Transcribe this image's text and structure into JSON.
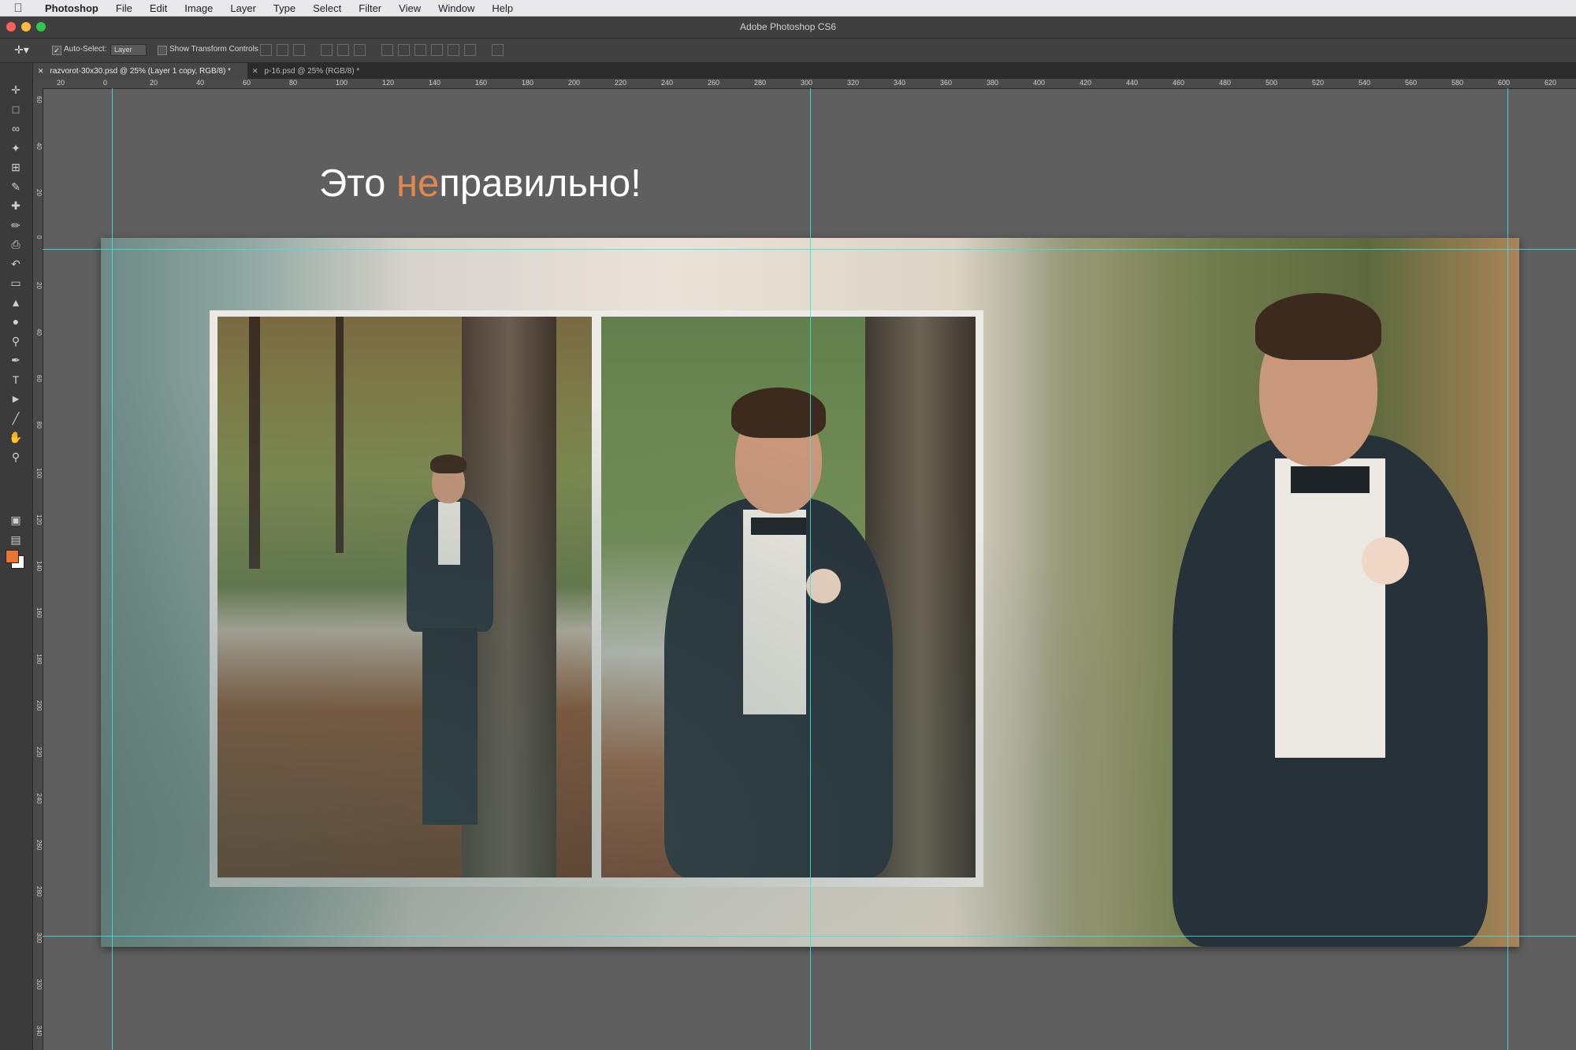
{
  "menubar": {
    "app": "Photoshop",
    "items": [
      "File",
      "Edit",
      "Image",
      "Layer",
      "Type",
      "Select",
      "Filter",
      "View",
      "Window",
      "Help"
    ]
  },
  "window": {
    "title": "Adobe Photoshop CS6"
  },
  "options_bar": {
    "auto_select_label": "Auto-Select:",
    "auto_select_checked": true,
    "auto_select_value": "Layer",
    "transform_label": "Show Transform Controls",
    "transform_checked": false
  },
  "tabs": [
    {
      "label": "razvorot-30x30.psd @ 25% (Layer 1 copy, RGB/8) *",
      "active": true
    },
    {
      "label": "p-16.psd @ 25% (RGB/8) *",
      "active": false
    }
  ],
  "ruler": {
    "h_ticks": [
      "20",
      "0",
      "20",
      "40",
      "60",
      "80",
      "100",
      "120",
      "140",
      "160",
      "180",
      "200",
      "220",
      "240",
      "260",
      "280",
      "300",
      "320",
      "340",
      "360",
      "380",
      "400",
      "420",
      "440",
      "460",
      "480",
      "500",
      "520",
      "540",
      "560",
      "580",
      "600",
      "620"
    ],
    "v_ticks": [
      "60",
      "40",
      "20",
      "0",
      "20",
      "40",
      "60",
      "80",
      "100",
      "120",
      "140",
      "160",
      "180",
      "200",
      "220",
      "240",
      "260",
      "280",
      "300",
      "320",
      "340"
    ]
  },
  "colors": {
    "foreground": "#e8762f",
    "background": "#ffffff",
    "guide": "#3ee0e0",
    "highlight": "#e0884e"
  },
  "canvas": {
    "heading_pre": "Это ",
    "heading_highlight": "не",
    "heading_post": "правильно!"
  },
  "toolbox": [
    "move-tool-icon",
    "marquee-tool-icon",
    "lasso-tool-icon",
    "magic-wand-icon",
    "crop-tool-icon",
    "eyedropper-icon",
    "healing-brush-icon",
    "brush-tool-icon",
    "clone-stamp-icon",
    "history-brush-icon",
    "eraser-icon",
    "paint-bucket-icon",
    "blur-tool-icon",
    "dodge-tool-icon",
    "pen-tool-icon",
    "type-tool-icon",
    "path-selection-icon",
    "line-tool-icon",
    "hand-tool-icon",
    "zoom-tool-icon"
  ]
}
